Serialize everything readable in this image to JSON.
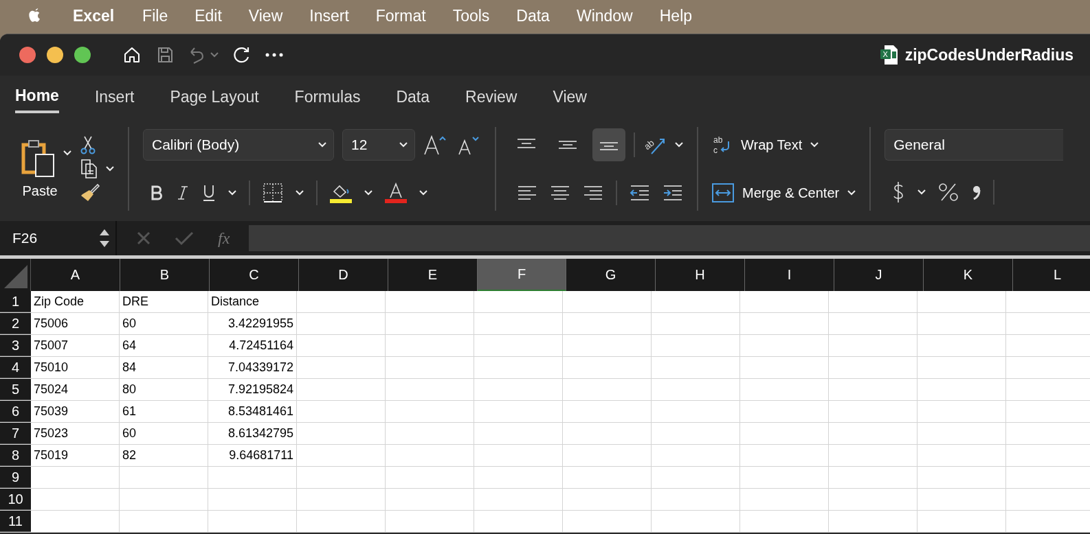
{
  "menu_bar": {
    "app_name": "Excel",
    "items": [
      "File",
      "Edit",
      "View",
      "Insert",
      "Format",
      "Tools",
      "Data",
      "Window",
      "Help"
    ]
  },
  "window": {
    "file_icon_letter": "X",
    "title": "zipCodesUnderRadius"
  },
  "ribbon_tabs": [
    {
      "label": "Home",
      "selected": true
    },
    {
      "label": "Insert",
      "selected": false
    },
    {
      "label": "Page Layout",
      "selected": false
    },
    {
      "label": "Formulas",
      "selected": false
    },
    {
      "label": "Data",
      "selected": false
    },
    {
      "label": "Review",
      "selected": false
    },
    {
      "label": "View",
      "selected": false
    }
  ],
  "ribbon": {
    "orientation_icon_text": "ab",
    "wrap_icon_text": [
      "ab",
      "c"
    ],
    "paste_label": "Paste",
    "font_name": "Calibri (Body)",
    "font_size": "12",
    "vertical_align": [
      {
        "selected": false
      },
      {
        "selected": false
      },
      {
        "selected": true
      }
    ],
    "wrap_text": "Wrap Text",
    "merge": "Merge & Center",
    "number_format": "General"
  },
  "formula_bar": {
    "name_box": "F26",
    "function_label": "fx"
  },
  "sheet": {
    "columns": [
      {
        "label": "A",
        "selected": false
      },
      {
        "label": "B",
        "selected": false
      },
      {
        "label": "C",
        "selected": false
      },
      {
        "label": "D",
        "selected": false
      },
      {
        "label": "E",
        "selected": false
      },
      {
        "label": "F",
        "selected": true
      },
      {
        "label": "G",
        "selected": false
      },
      {
        "label": "H",
        "selected": false
      },
      {
        "label": "I",
        "selected": false
      },
      {
        "label": "J",
        "selected": false
      },
      {
        "label": "K",
        "selected": false
      },
      {
        "label": "L",
        "selected": false
      }
    ],
    "rows": [
      {
        "number": "1",
        "cells": [
          {
            "text": "Zip Code",
            "kind": "text"
          },
          {
            "text": "DRE",
            "kind": "text"
          },
          {
            "text": "Distance",
            "kind": "text"
          }
        ]
      },
      {
        "number": "2",
        "cells": [
          {
            "text": "75006",
            "kind": "text"
          },
          {
            "text": "60",
            "kind": "text"
          },
          {
            "text": "3.42291955",
            "kind": "number"
          }
        ]
      },
      {
        "number": "3",
        "cells": [
          {
            "text": "75007",
            "kind": "text"
          },
          {
            "text": "64",
            "kind": "text"
          },
          {
            "text": "4.72451164",
            "kind": "number"
          }
        ]
      },
      {
        "number": "4",
        "cells": [
          {
            "text": "75010",
            "kind": "text"
          },
          {
            "text": "84",
            "kind": "text"
          },
          {
            "text": "7.04339172",
            "kind": "number"
          }
        ]
      },
      {
        "number": "5",
        "cells": [
          {
            "text": "75024",
            "kind": "text"
          },
          {
            "text": "80",
            "kind": "text"
          },
          {
            "text": "7.92195824",
            "kind": "number"
          }
        ]
      },
      {
        "number": "6",
        "cells": [
          {
            "text": "75039",
            "kind": "text"
          },
          {
            "text": "61",
            "kind": "text"
          },
          {
            "text": "8.53481461",
            "kind": "number"
          }
        ]
      },
      {
        "number": "7",
        "cells": [
          {
            "text": "75023",
            "kind": "text"
          },
          {
            "text": "60",
            "kind": "text"
          },
          {
            "text": "8.61342795",
            "kind": "number"
          }
        ]
      },
      {
        "number": "8",
        "cells": [
          {
            "text": "75019",
            "kind": "text"
          },
          {
            "text": "82",
            "kind": "text"
          },
          {
            "text": "9.64681711",
            "kind": "number"
          }
        ]
      },
      {
        "number": "9",
        "cells": []
      },
      {
        "number": "10",
        "cells": []
      },
      {
        "number": "11",
        "cells": []
      }
    ]
  }
}
